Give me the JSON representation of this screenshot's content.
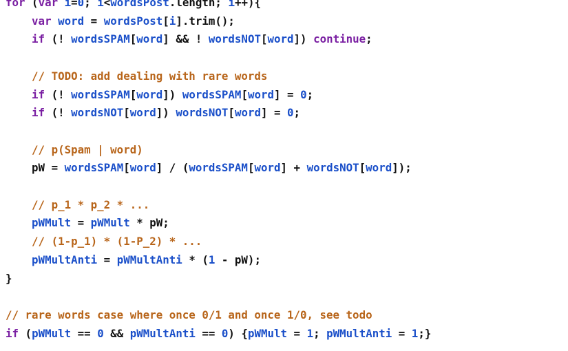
{
  "editor": {
    "lines": [
      {
        "tokens": [
          [
            "kw",
            "for"
          ],
          [
            "plain",
            " ("
          ],
          [
            "kw",
            "var"
          ],
          [
            "plain",
            " "
          ],
          [
            "var",
            "i"
          ],
          [
            "plain",
            "="
          ],
          [
            "num",
            "0"
          ],
          [
            "plain",
            "; "
          ],
          [
            "var",
            "i"
          ],
          [
            "plain",
            "<"
          ],
          [
            "var",
            "wordsPost"
          ],
          [
            "plain",
            ".length; "
          ],
          [
            "var",
            "i"
          ],
          [
            "plain",
            "++){"
          ]
        ]
      },
      {
        "tokens": [
          [
            "plain",
            "    "
          ],
          [
            "kw",
            "var"
          ],
          [
            "plain",
            " "
          ],
          [
            "var",
            "word"
          ],
          [
            "plain",
            " = "
          ],
          [
            "var",
            "wordsPost"
          ],
          [
            "plain",
            "["
          ],
          [
            "var",
            "i"
          ],
          [
            "plain",
            "].trim();"
          ]
        ]
      },
      {
        "tokens": [
          [
            "plain",
            "    "
          ],
          [
            "kw",
            "if"
          ],
          [
            "plain",
            " (! "
          ],
          [
            "var",
            "wordsSPAM"
          ],
          [
            "plain",
            "["
          ],
          [
            "var",
            "word"
          ],
          [
            "plain",
            "] && ! "
          ],
          [
            "var",
            "wordsNOT"
          ],
          [
            "plain",
            "["
          ],
          [
            "var",
            "word"
          ],
          [
            "plain",
            "]) "
          ],
          [
            "kw",
            "continue"
          ],
          [
            "plain",
            ";"
          ]
        ]
      },
      {
        "tokens": []
      },
      {
        "tokens": [
          [
            "plain",
            "    "
          ],
          [
            "com",
            "// TODO: add dealing with rare words"
          ]
        ]
      },
      {
        "tokens": [
          [
            "plain",
            "    "
          ],
          [
            "kw",
            "if"
          ],
          [
            "plain",
            " (! "
          ],
          [
            "var",
            "wordsSPAM"
          ],
          [
            "plain",
            "["
          ],
          [
            "var",
            "word"
          ],
          [
            "plain",
            "]) "
          ],
          [
            "var",
            "wordsSPAM"
          ],
          [
            "plain",
            "["
          ],
          [
            "var",
            "word"
          ],
          [
            "plain",
            "] = "
          ],
          [
            "num",
            "0"
          ],
          [
            "plain",
            ";"
          ]
        ]
      },
      {
        "tokens": [
          [
            "plain",
            "    "
          ],
          [
            "kw",
            "if"
          ],
          [
            "plain",
            " (! "
          ],
          [
            "var",
            "wordsNOT"
          ],
          [
            "plain",
            "["
          ],
          [
            "var",
            "word"
          ],
          [
            "plain",
            "]) "
          ],
          [
            "var",
            "wordsNOT"
          ],
          [
            "plain",
            "["
          ],
          [
            "var",
            "word"
          ],
          [
            "plain",
            "] = "
          ],
          [
            "num",
            "0"
          ],
          [
            "plain",
            ";"
          ]
        ]
      },
      {
        "tokens": []
      },
      {
        "tokens": [
          [
            "plain",
            "    "
          ],
          [
            "com",
            "// p(Spam | word)"
          ]
        ]
      },
      {
        "tokens": [
          [
            "plain",
            "    pW = "
          ],
          [
            "var",
            "wordsSPAM"
          ],
          [
            "plain",
            "["
          ],
          [
            "var",
            "word"
          ],
          [
            "plain",
            "] / ("
          ],
          [
            "var",
            "wordsSPAM"
          ],
          [
            "plain",
            "["
          ],
          [
            "var",
            "word"
          ],
          [
            "plain",
            "] + "
          ],
          [
            "var",
            "wordsNOT"
          ],
          [
            "plain",
            "["
          ],
          [
            "var",
            "word"
          ],
          [
            "plain",
            "]);"
          ]
        ]
      },
      {
        "tokens": []
      },
      {
        "tokens": [
          [
            "plain",
            "    "
          ],
          [
            "com",
            "// p_1 * p_2 * ..."
          ]
        ]
      },
      {
        "tokens": [
          [
            "plain",
            "    "
          ],
          [
            "var",
            "pWMult"
          ],
          [
            "plain",
            " = "
          ],
          [
            "var",
            "pWMult"
          ],
          [
            "plain",
            " * pW;"
          ]
        ]
      },
      {
        "tokens": [
          [
            "plain",
            "    "
          ],
          [
            "com",
            "// (1-p_1) * (1-P_2) * ..."
          ]
        ]
      },
      {
        "tokens": [
          [
            "plain",
            "    "
          ],
          [
            "var",
            "pWMultAnti"
          ],
          [
            "plain",
            " = "
          ],
          [
            "var",
            "pWMultAnti"
          ],
          [
            "plain",
            " * ("
          ],
          [
            "num",
            "1"
          ],
          [
            "plain",
            " - pW);"
          ]
        ]
      },
      {
        "tokens": [
          [
            "plain",
            "}"
          ]
        ]
      },
      {
        "tokens": []
      },
      {
        "tokens": [
          [
            "com",
            "// rare words case where once 0/1 and once 1/0, see todo"
          ]
        ]
      },
      {
        "tokens": [
          [
            "kw",
            "if"
          ],
          [
            "plain",
            " ("
          ],
          [
            "var",
            "pWMult"
          ],
          [
            "plain",
            " == "
          ],
          [
            "num",
            "0"
          ],
          [
            "plain",
            " && "
          ],
          [
            "var",
            "pWMultAnti"
          ],
          [
            "plain",
            " == "
          ],
          [
            "num",
            "0"
          ],
          [
            "plain",
            ") {"
          ],
          [
            "var",
            "pWMult"
          ],
          [
            "plain",
            " = "
          ],
          [
            "num",
            "1"
          ],
          [
            "plain",
            "; "
          ],
          [
            "var",
            "pWMultAnti"
          ],
          [
            "plain",
            " = "
          ],
          [
            "num",
            "1"
          ],
          [
            "plain",
            ";}"
          ]
        ]
      }
    ]
  },
  "colors": {
    "background": "#ffffff",
    "keyword": "#7a1fa2",
    "identifier": "#1a4fc9",
    "number": "#1a4fc9",
    "comment": "#b8651a",
    "text": "#111111"
  }
}
